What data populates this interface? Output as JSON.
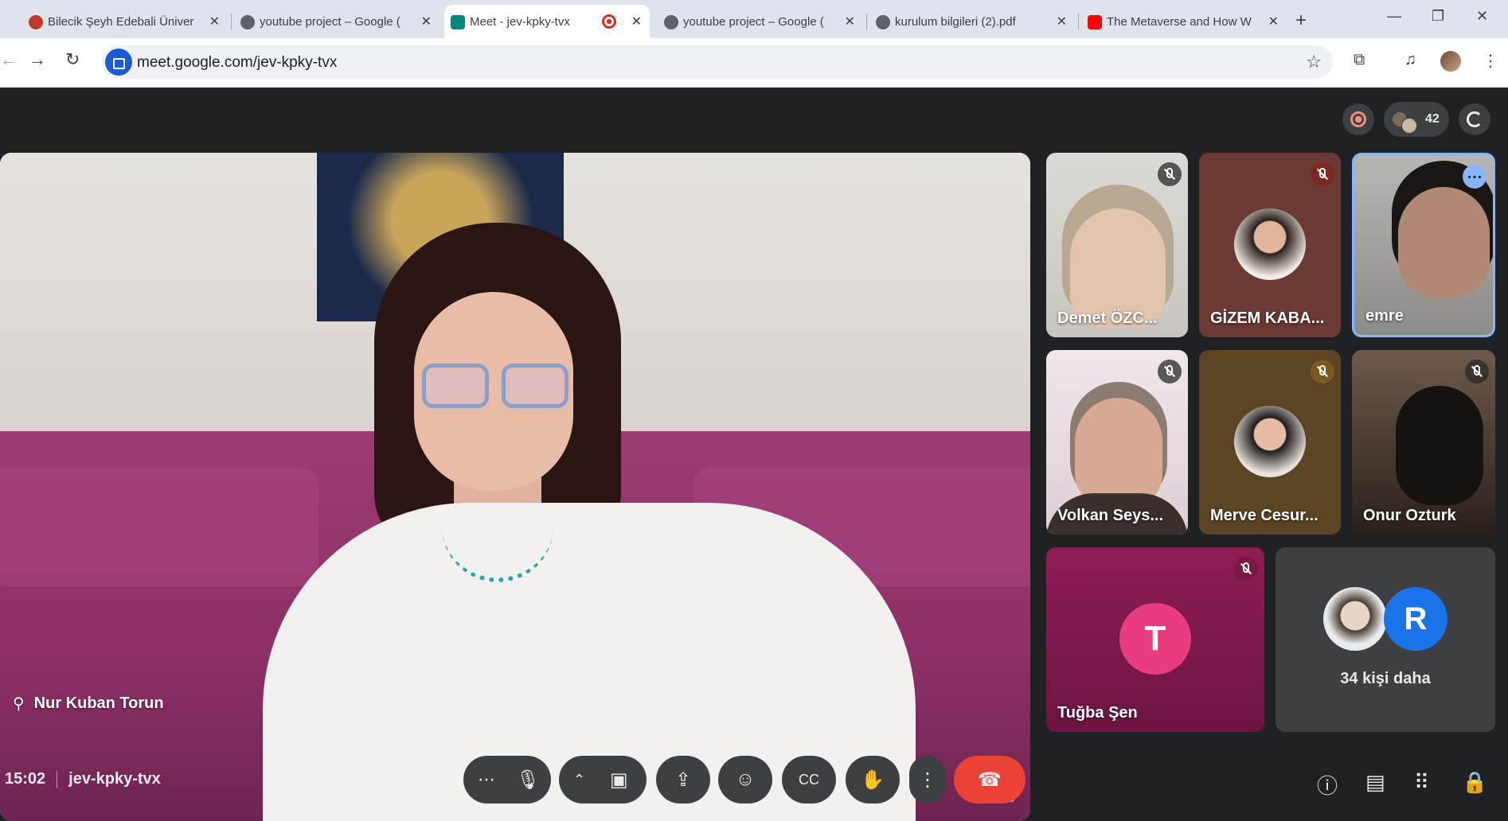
{
  "tabs": [
    {
      "title": "Bilecik Şeyh Edebali Üniver",
      "favicon_color": "#c0392b"
    },
    {
      "title": "youtube project – Google (",
      "favicon_color": "#5f6368"
    },
    {
      "title": "Meet - jev-kpky-tvx",
      "favicon_color": "#00897b"
    },
    {
      "title": "youtube project – Google (",
      "favicon_color": "#5f6368"
    },
    {
      "title": "kurulum bilgileri (2).pdf",
      "favicon_color": "#5f6368"
    },
    {
      "title": "The Metaverse and How W",
      "favicon_color": "#ff0000"
    }
  ],
  "window_controls": {
    "minimize": "—",
    "restore": "❐",
    "close": "✕"
  },
  "toolbar": {
    "url": "meet.google.com/jev-kpky-tvx"
  },
  "meet": {
    "participant_count": "42",
    "main_speaker": {
      "name": "Nur Kuban Torun"
    },
    "tiles": [
      {
        "name": "Demet ÖZC...",
        "bg": "#d9d5cf",
        "muted": true
      },
      {
        "name": "GİZEM KABA...",
        "bg": "#6b3a34",
        "muted": true
      },
      {
        "name": "emre",
        "bg": "#9b9a97",
        "muted": false
      },
      {
        "name": "Volkan Seys...",
        "bg": "#e6dde2",
        "muted": true
      },
      {
        "name": "Merve Cesur...",
        "bg": "#5a4424",
        "muted": true
      },
      {
        "name": "Onur Ozturk",
        "bg": "#3e2e23",
        "muted": true
      }
    ],
    "tugba": {
      "name": "Tuğba Şen",
      "initial": "T",
      "bg": "#8e1d55",
      "avatar_color": "#e83c7e"
    },
    "others": {
      "text": "34 kişi daha",
      "initial": "R",
      "avatar_color": "#1a73e8"
    },
    "time": "15:02",
    "code": "jev-kpky-tvx"
  }
}
